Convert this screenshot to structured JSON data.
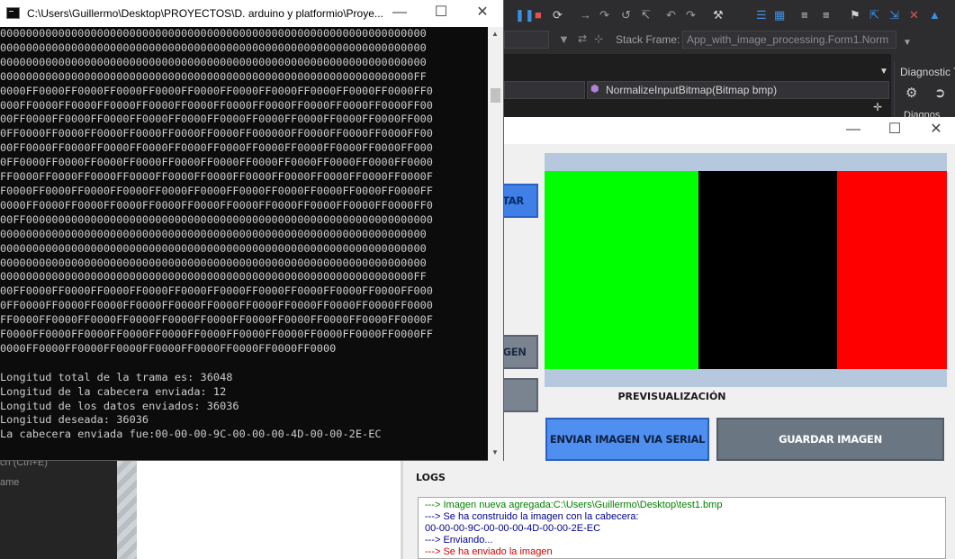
{
  "vs": {
    "stack_frame_label": "Stack Frame:",
    "stack_frame_value": "App_with_image_processing.Form1.Norm",
    "method_combo": "NormalizeInputBitmap(Bitmap bmp)",
    "diag_title": "Diagnostic T",
    "diag_tab": "Diagnos",
    "search_hint": "ch (Ctrl+E)",
    "name_col": "ame"
  },
  "console": {
    "title": "C:\\Users\\Guillermo\\Desktop\\PROYECTOS\\D. arduino y platformio\\Proye...",
    "lines": [
      "000000000000000000000000000000000000000000000000000000000000000000",
      "000000000000000000000000000000000000000000000000000000000000000000",
      "000000000000000000000000000000000000000000000000000000000000000000",
      "0000000000000000000000000000000000000000000000000000000000000000FF",
      "0000FF0000FF0000FF0000FF0000FF0000FF0000FF0000FF0000FF0000FF0000FF0",
      "000FF0000FF0000FF0000FF0000FF0000FF0000FF0000FF0000FF0000FF0000FF00",
      "00FF0000FF0000FF0000FF0000FF0000FF0000FF0000FF0000FF0000FF0000FF000",
      "0FF0000FF0000FF0000FF0000FF0000FF0000FF000000FF0000FF0000FF0000FF00",
      "00FF0000FF0000FF0000FF0000FF0000FF0000FF0000FF0000FF0000FF0000FF000",
      "0FF0000FF0000FF0000FF0000FF0000FF0000FF0000FF0000FF0000FF0000FF0000",
      "FF0000FF0000FF0000FF0000FF0000FF0000FF0000FF0000FF0000FF0000FF0000F",
      "F0000FF0000FF0000FF0000FF0000FF0000FF0000FF0000FF0000FF0000FF0000FF",
      "0000FF0000FF0000FF0000FF0000FF0000FF0000FF0000FF0000FF0000FF0000FF0",
      "00FF000000000000000000000000000000000000000000000000000000000000000",
      "000000000000000000000000000000000000000000000000000000000000000000",
      "000000000000000000000000000000000000000000000000000000000000000000",
      "000000000000000000000000000000000000000000000000000000000000000000",
      "0000000000000000000000000000000000000000000000000000000000000000FF",
      "00FF0000FF0000FF0000FF0000FF0000FF0000FF0000FF0000FF0000FF0000FF000",
      "0FF0000FF0000FF0000FF0000FF0000FF0000FF0000FF0000FF0000FF0000FF0000",
      "FF0000FF0000FF0000FF0000FF0000FF0000FF0000FF0000FF0000FF0000FF0000F",
      "F0000FF0000FF0000FF0000FF0000FF0000FF0000FF0000FF0000FF0000FF0000FF",
      "0000FF0000FF0000FF0000FF0000FF0000FF0000FF0000FF0000",
      "",
      "Longitud total de la trama es: 36048",
      "Longitud de la cabecera enviada: 12",
      "Longitud de los datos enviados: 36036",
      "Longitud deseada: 36036",
      "La cabecera enviada fue:00-00-00-9C-00-00-00-4D-00-00-2E-EC"
    ]
  },
  "form": {
    "btn_left_1": "CTAR",
    "btn_left_2": "AGEN",
    "preview_label": "PREVISUALIZACIÓN",
    "send_button": "ENVIAR IMAGEN VIA SERIAL",
    "save_button": "GUARDAR IMAGEN",
    "logs_label": "LOGS",
    "preview_colors": [
      "#00ff00",
      "#000000",
      "#ff0000"
    ],
    "logs": [
      {
        "text": "---> Imagen nueva agregada:C:\\Users\\Guillermo\\Desktop\\test1.bmp",
        "color": "#008000"
      },
      {
        "text": "---> Se ha construido la imagen con la cabecera:",
        "color": "#00008b"
      },
      {
        "text": "00-00-00-9C-00-00-00-4D-00-00-2E-EC",
        "color": "#00008b"
      },
      {
        "text": "---> Enviando...",
        "color": "#00008b"
      },
      {
        "text": "---> Se ha enviado la imagen",
        "color": "#d40000"
      }
    ]
  }
}
